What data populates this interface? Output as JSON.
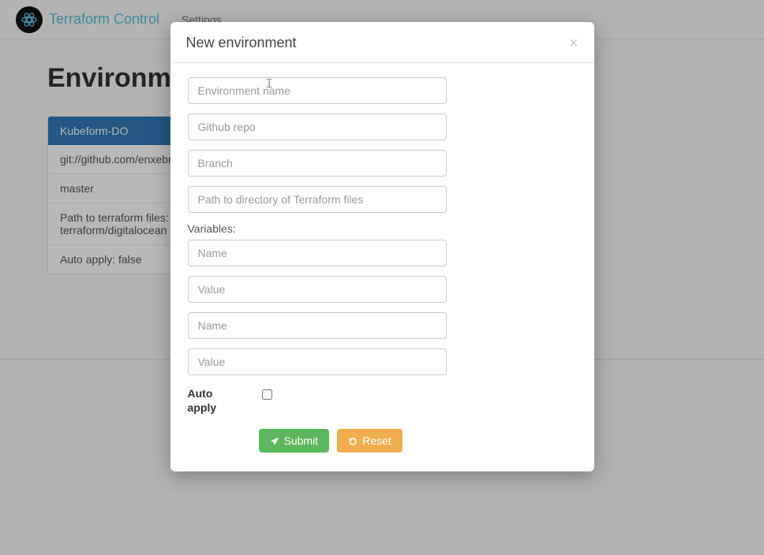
{
  "nav": {
    "brand": "Terraform Control",
    "settings": "Settings"
  },
  "page": {
    "title": "Environments"
  },
  "env_card": {
    "name": "Kubeform-DO",
    "repo": "git://github.com/enxebre/kubeform.g",
    "branch": "master",
    "path_label": "Path to terraform files:",
    "path_value": "terraform/digitalocean",
    "auto_apply": "Auto apply: false"
  },
  "modal": {
    "title": "New environment",
    "close": "×",
    "placeholders": {
      "env_name": "Environment name",
      "github_repo": "Github repo",
      "branch": "Branch",
      "tf_path": "Path to directory of Terraform files",
      "var_name": "Name",
      "var_value": "Value"
    },
    "variables_label": "Variables:",
    "auto_apply_label": "Auto apply",
    "submit": "Submit",
    "reset": "Reset"
  }
}
